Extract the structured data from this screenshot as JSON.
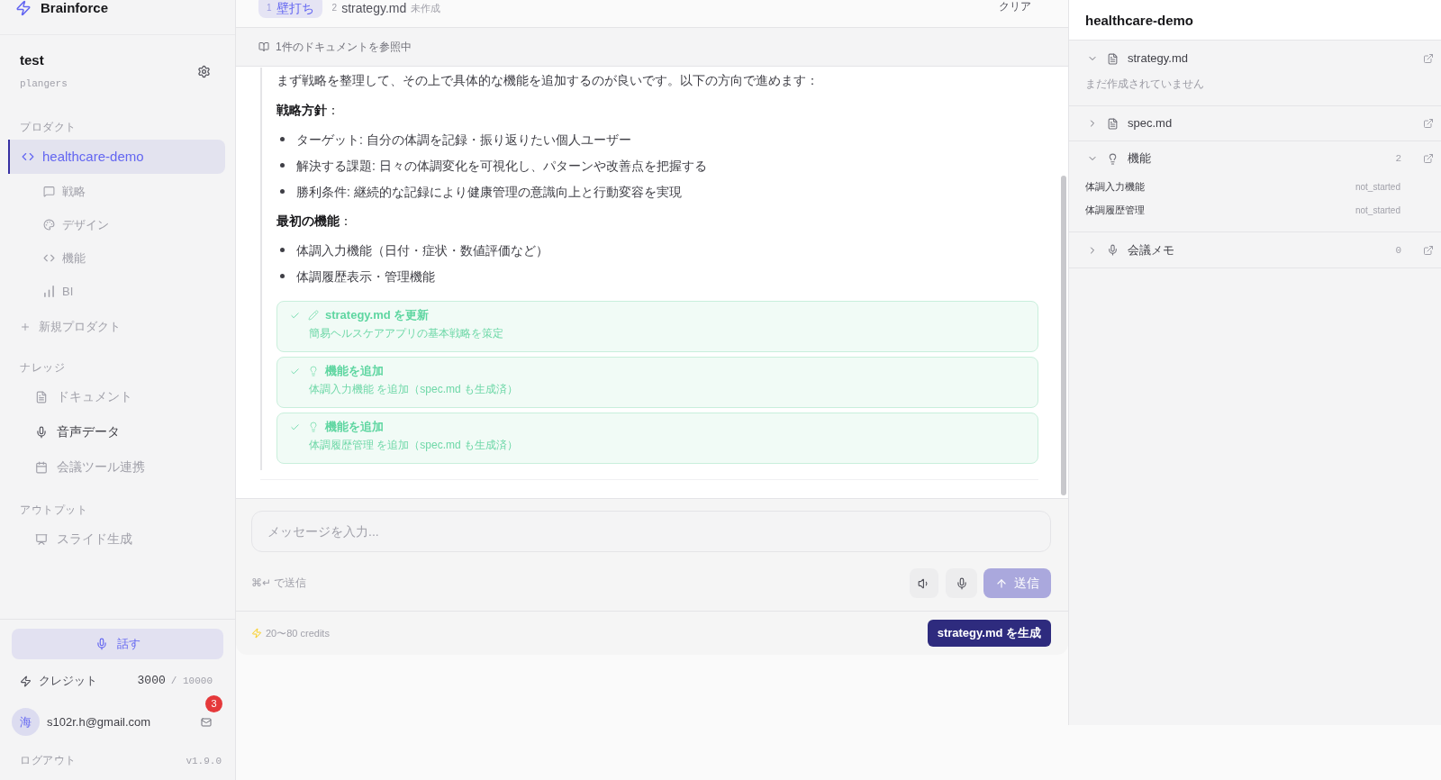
{
  "sidebar": {
    "brand": "Brainforce",
    "workspace": {
      "name": "test",
      "org": "plangers"
    },
    "products_heading": "プロダクト",
    "products": [
      {
        "label": "healthcare-demo",
        "selected": true,
        "children": [
          {
            "label": "戦略"
          },
          {
            "label": "デザイン"
          },
          {
            "label": "機能"
          },
          {
            "label": "BI"
          }
        ]
      }
    ],
    "new_product": "新規プロダクト",
    "knowledge_heading": "ナレッジ",
    "knowledge": [
      {
        "label": "ドキュメント",
        "hovered": false
      },
      {
        "label": "音声データ",
        "hovered": true
      },
      {
        "label": "会議ツール連携",
        "hovered": false
      }
    ],
    "output_heading": "アウトプット",
    "outputs": [
      {
        "label": "スライド生成",
        "hovered": false
      }
    ],
    "talk_button": "話す",
    "credits": {
      "label": "クレジット",
      "used": "3000",
      "total": "/ 10000"
    },
    "user": {
      "avatar": "海",
      "email": "s102r.h@gmail.com",
      "unread": "3"
    },
    "logout": "ログアウト",
    "version": "v1.9.0"
  },
  "tabs": [
    {
      "number": "1",
      "label": "壁打ち",
      "selected": true
    },
    {
      "number": "2",
      "label": "strategy.md",
      "status": "未作成",
      "selected": false
    }
  ],
  "clear_button": "クリア",
  "reference": "1件のドキュメントを参照中",
  "message": {
    "blocks": [
      {
        "kind": "paragraph",
        "text": "まず戦略を整理して、その上で具体的な機能を追加するのが良いです。以下の方向で進めます："
      },
      {
        "kind": "heading",
        "text": "**戦略方針**："
      },
      {
        "kind": "bullet",
        "text": "ターゲット: 自分の体調を記録・振り返りたい個人ユーザー"
      },
      {
        "kind": "bullet",
        "text": "解決する課題: 日々の体調変化を可視化し、パターンや改善点を把握する"
      },
      {
        "kind": "bullet",
        "text": "勝利条件: 継続的な記録により健康管理の意識向上と行動変容を実現"
      },
      {
        "kind": "heading",
        "text": "**最初の機能**："
      },
      {
        "kind": "bullet",
        "text": "体調入力機能（日付・症状・数値評価など）"
      },
      {
        "kind": "bullet",
        "text": "体調履歴表示・管理機能"
      }
    ],
    "actions": [
      {
        "kind": "document",
        "done": true,
        "title": "strategy.md を更新",
        "detail": "簡易ヘルスケアアプリの基本戦略を策定"
      },
      {
        "kind": "feature",
        "done": true,
        "title": "機能を追加",
        "detail": "体調入力機能 を追加（spec.md も生成済）"
      },
      {
        "kind": "feature",
        "done": true,
        "title": "機能を追加",
        "detail": "体調履歴管理 を追加（spec.md も生成済）"
      }
    ]
  },
  "composer": {
    "placeholder": "メッセージを入力...",
    "shortcut": "⌘↵ で送信",
    "send_button": {
      "label": "送信",
      "disabled": true
    }
  },
  "footer": {
    "credits": "20〜80 credits",
    "generate_button": "strategy.md を生成"
  },
  "panel": {
    "title": "healthcare-demo",
    "sections": [
      {
        "kind": "document",
        "label": "strategy.md",
        "expanded": true,
        "note": "まだ作成されていません"
      },
      {
        "kind": "document",
        "label": "spec.md",
        "expanded": false
      },
      {
        "kind": "feature",
        "label": "機能",
        "expanded": true,
        "count": "2",
        "items": [
          {
            "name": "体調入力機能",
            "status": "not_started"
          },
          {
            "name": "体調履歴管理",
            "status": "not_started"
          }
        ]
      },
      {
        "kind": "voice",
        "label": "会議メモ",
        "expanded": false,
        "count": "0"
      }
    ]
  }
}
